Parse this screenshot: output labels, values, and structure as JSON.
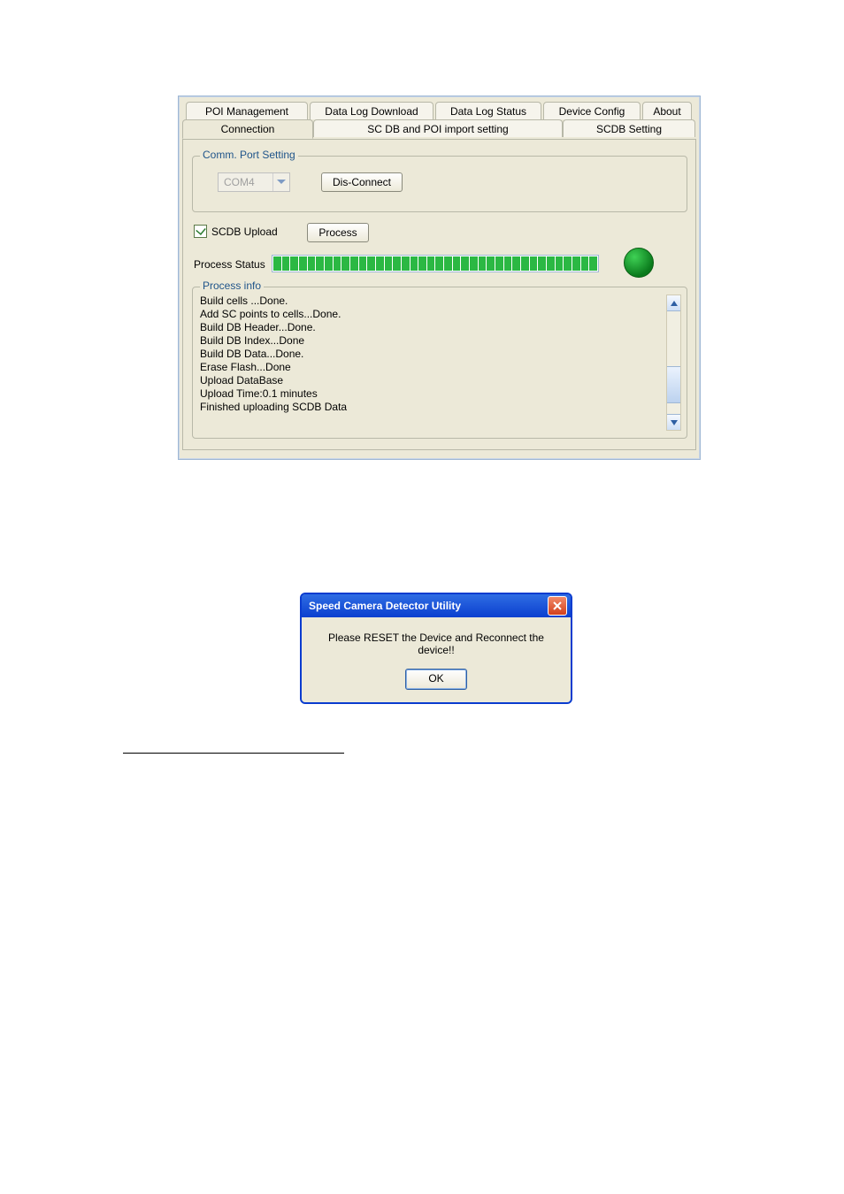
{
  "tabs_back": {
    "poi_mgmt": "POI Management",
    "data_log_download": "Data Log Download",
    "data_log_status": "Data Log Status",
    "device_config": "Device Config",
    "about": "About"
  },
  "tabs_front": {
    "connection": "Connection",
    "scdb_poi": "SC DB and POI import setting",
    "scdb_setting": "SCDB  Setting"
  },
  "comm_port": {
    "legend": "Comm. Port Setting",
    "combo_value": "COM4",
    "disconnect_btn": "Dis-Connect"
  },
  "scdb_upload": {
    "checkbox_label": "SCDB Upload",
    "checked": true,
    "process_btn": "Process"
  },
  "process_status": {
    "label": "Process Status"
  },
  "process_info": {
    "legend": "Process info",
    "lines": [
      "Build cells ...Done.",
      "Add SC points to cells...Done.",
      "Build DB Header...Done.",
      "Build DB Index...Done",
      "Build DB Data...Done.",
      "Erase Flash...Done",
      "Upload DataBase",
      "Upload Time:0.1 minutes",
      "Finished uploading SCDB Data"
    ]
  },
  "dialog": {
    "title": "Speed Camera Detector Utility",
    "message": "Please RESET the Device and Reconnect the device!!",
    "ok": "OK"
  }
}
